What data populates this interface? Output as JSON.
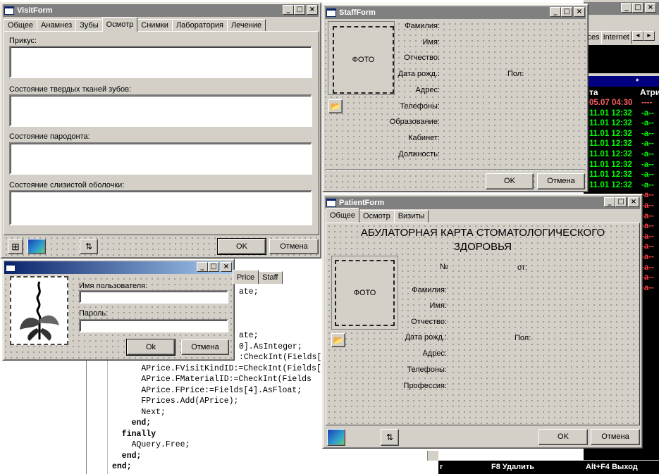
{
  "visitForm": {
    "title": "VisitForm",
    "tabs": [
      "Общее",
      "Анамнез",
      "Зубы",
      "Осмотр",
      "Снимки",
      "Лаборатория",
      "Лечение"
    ],
    "selectedTab": 3,
    "labels": [
      "Прикус:",
      "Состояние твердых тканей зубов:",
      "Состояние пародонта:",
      "Состояние слизистой оболочки:"
    ],
    "ok": "OK",
    "cancel": "Отмена"
  },
  "staffForm": {
    "title": "StaffForm",
    "photo": "ФОТО",
    "ok": "OK",
    "cancel": "Отмена",
    "pol": "Пол:",
    "labels": [
      "Фамилия:",
      "Имя:",
      "Отчество:",
      "Дата рожд.:",
      "Адрес:",
      "Телефоны:",
      "Образование:",
      "Кабинет:",
      "Должность:"
    ]
  },
  "patientForm": {
    "title": "PatientForm",
    "tabs": [
      "Общее",
      "Осмотр",
      "Визиты"
    ],
    "selectedTab": 0,
    "heading1": "АБУЛАТОРНАЯ КАРТА СТОМАТОЛОГИЧЕСКОГО",
    "heading2": "ЗДОРОВЬЯ",
    "photo": "ФОТО",
    "num": "№",
    "from": "от:",
    "pol": "Пол:",
    "labels": [
      "Фамилия:",
      "Имя:",
      "Отчество:",
      "Дата рожд.:",
      "Адрес:",
      "Телефоны:",
      "Профессия:"
    ],
    "ok": "OK",
    "cancel": "Отмена"
  },
  "loginForm": {
    "userLabel": "Имя пользователя:",
    "passLabel": "Пароль:",
    "ok": "Ok",
    "cancel": "Отмена"
  },
  "editor": {
    "tabs": [
      "Price",
      "Staff"
    ],
    "lines": [
      {
        "t": "ate;",
        "k": false
      },
      {
        "t": "",
        "k": false
      },
      {
        "t": "",
        "k": false
      },
      {
        "t": "",
        "k": false
      },
      {
        "t": "ate;",
        "k": false
      },
      {
        "t": "0].AsInteger;",
        "k": false
      },
      {
        "t": ":CheckInt(Fields[1",
        "k": false
      },
      {
        "t": "      APrice.FVisitKindID:=CheckInt(Fields[",
        "k": false
      },
      {
        "t": "      APrice.FMaterialID:=CheckInt(Fields",
        "k": false
      },
      {
        "t": "      APrice.FPrice:=Fields[4].AsFloat;",
        "k": false
      },
      {
        "t": "      FPrices.Add(APrice);",
        "k": false
      },
      {
        "t": "      Next;",
        "k": false
      },
      {
        "t": "    end;",
        "k": true
      },
      {
        "t": "  finally",
        "k": true
      },
      {
        "t": "    AQuery.Free;",
        "k": false
      },
      {
        "t": "  end;",
        "k": true
      },
      {
        "t": "end;",
        "k": true
      }
    ]
  },
  "bgWindow": {
    "tabs": [
      "ices",
      "Internet"
    ],
    "col1": "та",
    "col2": "Атри",
    "dates": [
      "05.07 04:30",
      "11.01 12:32",
      "11.01 12:32",
      "11.01 12:32",
      "11.01 12:32",
      "11.01 12:32",
      "11.01 12:32",
      "11.01 12:32",
      "11.01 12:32"
    ],
    "attrs": [
      "----",
      "-a--",
      "-a--",
      "-a--",
      "-a--",
      "-a--",
      "-a--",
      "-a--",
      "-a--",
      "-a--",
      "-a--",
      "-a--",
      "-a--",
      "-a--",
      "-a--",
      "-a--",
      "-a--",
      "-a--",
      "-a--"
    ],
    "f8": "F8 Удалить",
    "altf4": "Alt+F4 Выход",
    "star": "*",
    "g": "г"
  }
}
